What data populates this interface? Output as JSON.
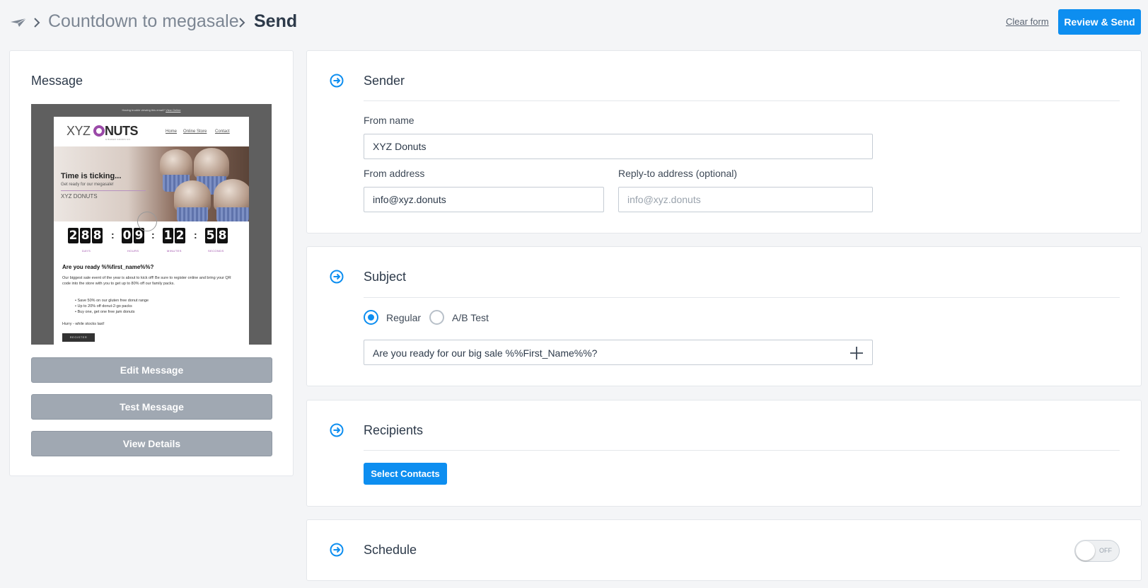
{
  "breadcrumb": {
    "campaign": "Countdown to megasale",
    "current": "Send"
  },
  "header": {
    "clear_form": "Clear form",
    "review_send": "Review & Send"
  },
  "message": {
    "title": "Message",
    "preview": {
      "top_text": "Having trouble viewing this email?",
      "top_link": "View Online",
      "brand": "XYZ",
      "brand_bold": "NUTS",
      "brand_sub": "& BAKED GOODS CO.",
      "nav": [
        "Home",
        "Online Store",
        "Contact"
      ],
      "hero_title": "Time is ticking...",
      "hero_sub": "Get ready for our megasale!",
      "hero_logo": "XYZ DONUTS",
      "countdown": {
        "days": "288",
        "hours": "09",
        "minutes": "12",
        "seconds": "58",
        "labels": [
          "DAYS",
          "HOURS",
          "MINUTES",
          "SECONDS"
        ]
      },
      "question": "Are you ready %%first_name%%?",
      "paragraph": "Our biggest sale event of the year is about to kick off! Be sure to register online and bring your QR code into the store with you to get up to 80% off our family packs.",
      "bullets": [
        "Save 50% on our gluten free donut range",
        "Up to 20% off donut-2-go packs",
        "Buy one, get one free jam donuts"
      ],
      "hurry": "Hurry - while stocks last!",
      "register": "REGISTER"
    },
    "buttons": {
      "edit": "Edit Message",
      "test": "Test Message",
      "details": "View Details"
    }
  },
  "sender": {
    "title": "Sender",
    "from_name_label": "From name",
    "from_name_value": "XYZ Donuts",
    "from_address_label": "From address",
    "from_address_value": "info@xyz.donuts",
    "reply_to_label": "Reply-to address (optional)",
    "reply_to_placeholder": "info@xyz.donuts"
  },
  "subject": {
    "title": "Subject",
    "option_regular": "Regular",
    "option_ab": "A/B Test",
    "selected": "Regular",
    "value": "Are you ready for our big sale %%First_Name%%?"
  },
  "recipients": {
    "title": "Recipients",
    "select_contacts": "Select Contacts"
  },
  "schedule": {
    "title": "Schedule",
    "toggle_state": "OFF"
  },
  "colors": {
    "accent": "#0d8ef0",
    "button_gray": "#a0a8b2",
    "background": "#f4f5f7"
  },
  "icons": {
    "logo": "paper-plane-icon",
    "separator": "chevron-right-icon",
    "section": "arrow-circle-right-icon",
    "add": "plus-icon"
  }
}
